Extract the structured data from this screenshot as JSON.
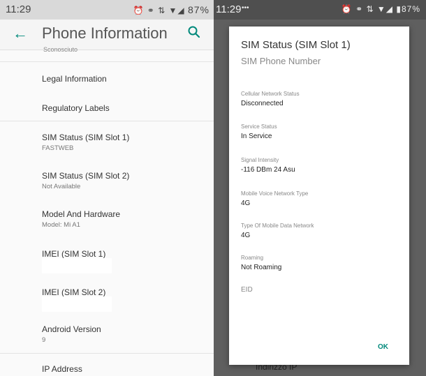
{
  "left": {
    "status": {
      "time": "11:29",
      "icons": "⏰ ⚭ ⇅ ▼◢",
      "battery": "87%"
    },
    "appbar": {
      "title": "Phone Information"
    },
    "cut_text": "Sconosciuto",
    "items": [
      {
        "title": "Legal Information",
        "subtitle": ""
      },
      {
        "title": "Regulatory Labels",
        "subtitle": ""
      },
      {
        "title": "SIM Status (SIM Slot 1)",
        "subtitle": "FASTWEB"
      },
      {
        "title": "SIM Status (SIM Slot 2)",
        "subtitle": "Not Available"
      },
      {
        "title": "Model And Hardware",
        "subtitle": "Model: Mi A1"
      },
      {
        "title": "IMEI (SIM Slot 1)",
        "subtitle": ""
      },
      {
        "title": "IMEI (SIM Slot 2)",
        "subtitle": ""
      },
      {
        "title": "Android Version",
        "subtitle": "9"
      },
      {
        "title": "IP Address",
        "subtitle": ""
      }
    ]
  },
  "right": {
    "status": {
      "time": "11:29",
      "dots": "•••",
      "icons": "⏰ ⚭ ⇅ ▼◢ ▮87%"
    },
    "behind_text": "Indirizzo IP",
    "dialog": {
      "title": "SIM Status (SIM Slot 1)",
      "subtitle": "SIM Phone Number",
      "fields": [
        {
          "label": "Cellular Network Status",
          "value": "Disconnected"
        },
        {
          "label": "Service Status",
          "value": "In Service"
        },
        {
          "label": "Signal Intensity",
          "value": "-116 DBm 24 Asu"
        },
        {
          "label": "Mobile Voice Network Type",
          "value": "4G"
        },
        {
          "label": "Type Of Mobile Data Network",
          "value": "4G"
        },
        {
          "label": "Roaming",
          "value": "Not Roaming"
        }
      ],
      "eid_label": "EID",
      "ok_label": "OK"
    }
  },
  "colors": {
    "accent": "#00897b"
  }
}
